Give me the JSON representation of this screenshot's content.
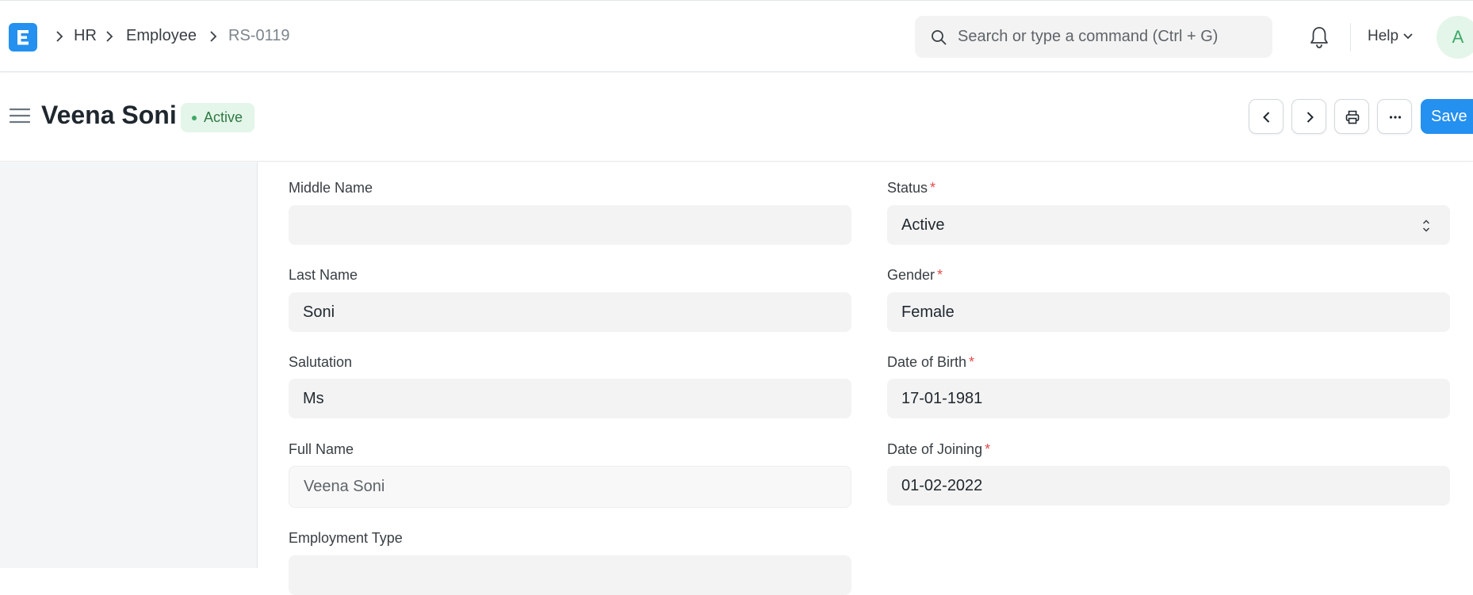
{
  "navbar": {
    "breadcrumbs": [
      "HR",
      "Employee",
      "RS-0119"
    ],
    "search_placeholder": "Search or type a command (Ctrl + G)",
    "help_label": "Help",
    "avatar_initial": "A",
    "logo_letter": "E"
  },
  "page": {
    "title": "Veena Soni",
    "status_badge": "Active",
    "save_label": "Save"
  },
  "form": {
    "middle_name": {
      "label": "Middle Name",
      "value": ""
    },
    "last_name": {
      "label": "Last Name",
      "value": "Soni"
    },
    "salutation": {
      "label": "Salutation",
      "value": "Ms"
    },
    "full_name": {
      "label": "Full Name",
      "value": "Veena Soni"
    },
    "employment_type": {
      "label": "Employment Type",
      "value": ""
    },
    "status": {
      "label": "Status",
      "value": "Active",
      "required": "*"
    },
    "gender": {
      "label": "Gender",
      "value": "Female",
      "required": "*"
    },
    "date_of_birth": {
      "label": "Date of Birth",
      "value": "17-01-1981",
      "required": "*"
    },
    "date_of_joining": {
      "label": "Date of Joining",
      "value": "01-02-2022",
      "required": "*"
    }
  },
  "colors": {
    "accent": "#2490ef",
    "active_badge_bg": "#e4f5e9",
    "active_badge_text": "#2f7a45",
    "required": "#e24c4c"
  },
  "icons": [
    "app-logo-icon",
    "chevron-right-icon",
    "search-icon",
    "bell-icon",
    "chevron-down-icon",
    "hamburger-icon",
    "chevron-left-icon",
    "printer-icon",
    "more-icon",
    "select-arrows-icon"
  ]
}
